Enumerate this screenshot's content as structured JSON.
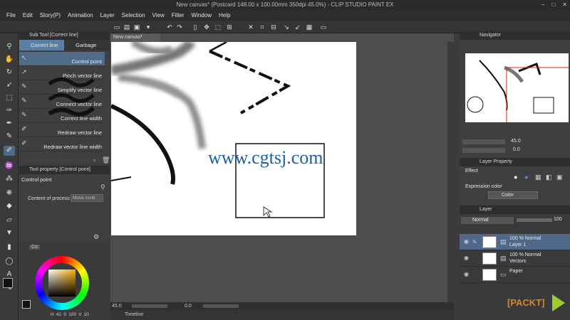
{
  "window": {
    "title": "New canvas* (Postcard 148.00 x 100.00mm 350dpi 45.0%) - CLIP STUDIO PAINT EX"
  },
  "menu": [
    "File",
    "Edit",
    "Story(P)",
    "Animation",
    "Layer",
    "Selection",
    "View",
    "Filter",
    "Window",
    "Help"
  ],
  "subtool": {
    "panel_title": "Sub Tool [Correct line]",
    "tabs": [
      "Correct line",
      "Garbage clean"
    ],
    "items": [
      "Control point",
      "Pinch vector line",
      "Simplify vector line",
      "Connect vector line",
      "Correct line width",
      "Redraw vector line",
      "Redraw vector line width"
    ]
  },
  "toolprop": {
    "panel_title": "Tool property [Control point]",
    "tool_name": "Control point",
    "process_label": "Content of process",
    "process_value": "Move contr"
  },
  "color": {
    "tab": "Co",
    "h_label": "H",
    "h_value": "42",
    "s_label": "S",
    "s_value": "100",
    "v_label": "V",
    "v_value": "10"
  },
  "canvas": {
    "tab_label": "New canvas*",
    "watermark": "www.cgtsj.com"
  },
  "status": {
    "zoom": "45.0",
    "rotation": "0.0"
  },
  "timeline": {
    "label": "Timeline"
  },
  "navigator": {
    "title": "Navigator",
    "zoom": "45.0",
    "angle": "0.0"
  },
  "layer_property": {
    "title": "Layer Property",
    "effect_label": "Effect",
    "expression_label": "Expression color",
    "expression_value": "Color"
  },
  "layers": {
    "title": "Layer",
    "blend_mode": "Normal",
    "opacity": "100",
    "items": [
      {
        "line1": "100 %  Normal",
        "line2": "Layer 1",
        "selected": true
      },
      {
        "line1": "100 %  Normal",
        "line2": "Vectors",
        "selected": false
      },
      {
        "line1": "",
        "line2": "Paper",
        "selected": false
      }
    ]
  },
  "brand": {
    "text": "[PACKT]"
  },
  "colors": {
    "accent": "#5b7fa3",
    "selection": "#50698a",
    "watermark": "#1b5fa8"
  }
}
